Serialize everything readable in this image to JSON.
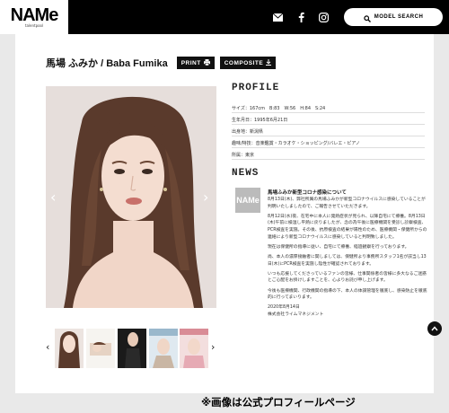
{
  "header": {
    "logo_main": "NAMe",
    "logo_sub": "talentpool",
    "search_label": "MODEL SEARCH",
    "icons": [
      "mail-icon",
      "facebook-icon",
      "instagram-icon",
      "search-icon"
    ]
  },
  "profile_header": {
    "name": "馬場 ふみか / Baba Fumika",
    "print_label": "PRINT",
    "composite_label": "COMPOSITE"
  },
  "profile": {
    "title": "PROFILE",
    "size": "サイズ：167cm　B:83　W:56　H:84　S:24",
    "birthday": "生年月日：1995年6月21日",
    "birthplace": "出身地：新潟県",
    "hobbies": "趣味/特技：音楽鑑賞・カラオケ・ショッピング/バレエ・ピアノ",
    "agency": "所属：東京"
  },
  "news": {
    "title": "NEWS",
    "logo": "NAMe",
    "headline": "馬場ふみか新型コロナ感染について",
    "paragraphs": [
      "8月13日(木)、弊社所属の馬場ふみかが新型コロナウイルスに感染していることが判明いたしましたので、ご報告させていただきます。",
      "8月12日(水)夜、在宅中に本人に発熱症状が見られ、以降自宅にて療養。8月13日(木)午前に検温し平熱に戻りましたが、念の為午後に医療機関を受診し診察検査、PCR検査を実施。その後、抗原検査の結果が陽性のため、医療機関・保健所からの連絡により新型コロナウイルスに感染していると判明致しました。",
      "現在は保健所の指導に従い、自宅にて療養、経過観察を行っております。",
      "尚、本人の濃厚接触者に関しましては、保健所より事務所スタッフ1名が該当し13日(木)にPCR検査を実施し陰性が確認されております。",
      "いつも応援してくださっているファンの皆様、仕事関係者の皆様に多大なるご迷惑とご心配をお掛けしますことを、心よりお詫び申し上げます。",
      "今後も医療機関、行政機関の指導の下、本人の体調管理を徹底し、感染防止を徹底的に行ってまいります。",
      "2020年8月14日",
      "株式会社ライムマネジメント"
    ]
  },
  "caption": "※画像は公式プロフィールページ",
  "colors": {
    "header_bg": "#000000",
    "panel_bg": "#ffffff",
    "page_bg": "#e9e9e9"
  }
}
